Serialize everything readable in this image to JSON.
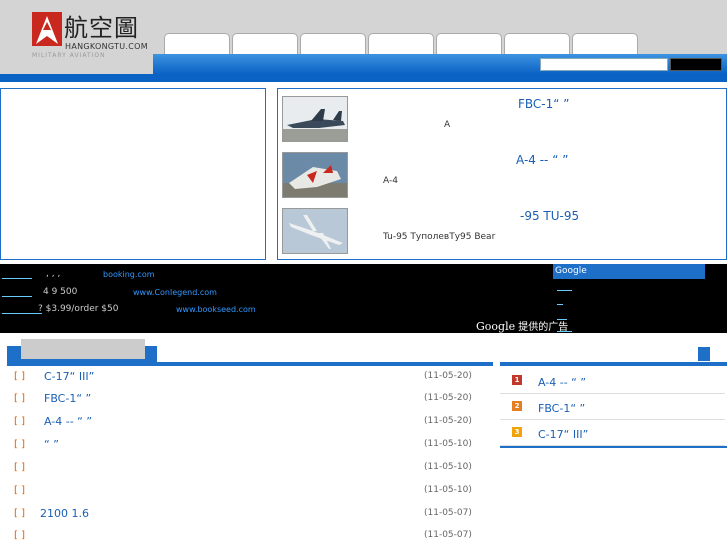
{
  "logo": {
    "cn": "航空圖",
    "en": "HANGKONGTU.COM",
    "en2": "MILITARY AVIATION"
  },
  "colors": {
    "brand_blue": "#1e6fc8",
    "header_gray": "#d4d4d4",
    "rank1": "#c0392b",
    "rank2": "#e67e22",
    "rank3": "#f0a30a"
  },
  "featured": [
    {
      "title": "FBC-1“ ”",
      "desc": "A"
    },
    {
      "title": "A-4 -- “ ”",
      "desc": "A-4"
    },
    {
      "title": "-95 TU-95",
      "desc": "Tu-95 ТуполевТу95 Bear"
    }
  ],
  "ads": [
    {
      "desc": ",        ,        ,",
      "url": "booking.com"
    },
    {
      "desc": "4  9                    500",
      "url": "www.Conlegend.com"
    },
    {
      "desc": "?                        $3.99/order  $50",
      "url": "www.bookseed.com"
    }
  ],
  "google_ad_label": "提供的广告",
  "google_word": "Google",
  "google_panel_label": "Google",
  "news_list": [
    {
      "title": "C-17“    III”",
      "date": "(11-05-20)"
    },
    {
      "title": "   FBC-1“ ”",
      "date": "(11-05-20)"
    },
    {
      "title": "A-4   --     “  ”",
      "date": "(11-05-20)"
    },
    {
      "title": "      “  ”",
      "date": "(11-05-10)"
    },
    {
      "title": "",
      "date": "(11-05-10)"
    },
    {
      "title": "",
      "date": "(11-05-10)"
    },
    {
      "title": "2100        1.6",
      "date": "(11-05-07)"
    },
    {
      "title": "",
      "date": "(11-05-07)"
    }
  ],
  "ranking": [
    {
      "num": "1",
      "title": "A-4   --     “  ”"
    },
    {
      "num": "2",
      "title": "   FBC-1“ ”"
    },
    {
      "num": "3",
      "title": "C-17“    III”"
    }
  ],
  "bracket": "[  ]"
}
